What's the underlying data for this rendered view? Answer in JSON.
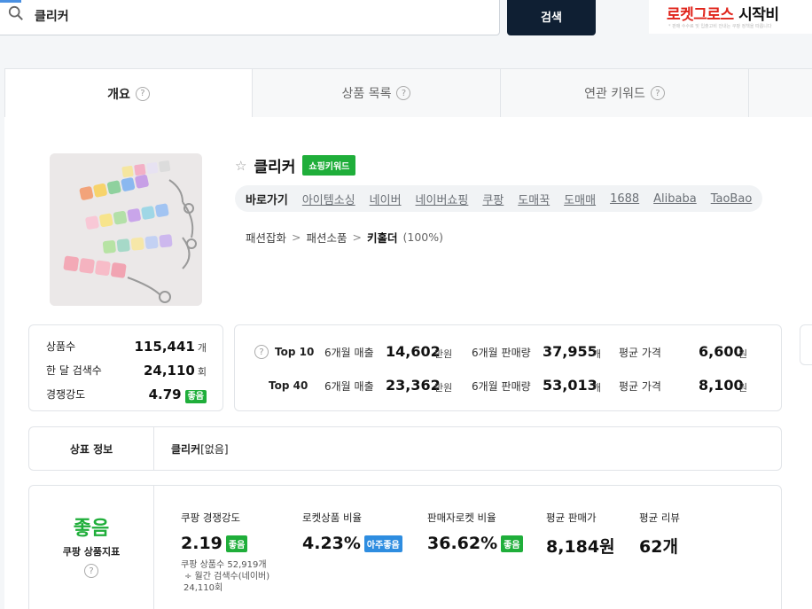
{
  "search": {
    "value": "클리커",
    "button_label": "검색"
  },
  "banner": {
    "text_red": "로켓그로스",
    "text_black": " 시작비",
    "subtext": "* 판매 수수료 및 입출고비 안내는 쿠팡 정책을 따릅니다"
  },
  "tabs": [
    {
      "label": "개요"
    },
    {
      "label": "상품 목록"
    },
    {
      "label": "연관 키워드"
    }
  ],
  "product": {
    "title": "클리커",
    "badge": "쇼핑키워드",
    "shortcut_label": "바로가기",
    "shortcuts": [
      "아이템소싱",
      "네이버",
      "네이버쇼핑",
      "쿠팡",
      "도매꾹",
      "도매매",
      "1688",
      "Alibaba",
      "TaoBao"
    ],
    "breadcrumb": [
      "패션잡화",
      "패션소품",
      "키홀더"
    ],
    "breadcrumb_pct": "(100%)"
  },
  "summary": {
    "product_count_label": "상품수",
    "product_count": "115,441",
    "product_count_unit": "개",
    "monthly_search_label": "한 달 검색수",
    "monthly_search": "24,110",
    "monthly_search_unit": "회",
    "competition_label": "경쟁강도",
    "competition": "4.79",
    "competition_tag": "좋음"
  },
  "top_stats": {
    "rows": [
      {
        "rank": "Top 10",
        "sales_label": "6개월 매출",
        "sales": "14,602",
        "sales_unit": "만원",
        "volume_label": "6개월 판매량",
        "volume": "37,955",
        "volume_unit": "개",
        "price_label": "평균 가격",
        "price": "6,600",
        "price_unit": "원"
      },
      {
        "rank": "Top 40",
        "sales_label": "6개월 매출",
        "sales": "23,362",
        "sales_unit": "만원",
        "volume_label": "6개월 판매량",
        "volume": "53,013",
        "volume_unit": "개",
        "price_label": "평균 가격",
        "price": "8,100",
        "price_unit": "원"
      }
    ]
  },
  "brand": {
    "label": "상표 정보",
    "value": "클리커",
    "value_suffix": "[없음]"
  },
  "coupang": {
    "grade": "좋음",
    "grade_label": "쿠팡 상품지표",
    "competition_label": "쿠팡 경쟁강도",
    "competition": "2.19",
    "competition_tag": "좋음",
    "competition_sub1": "쿠팡 상품수 52,919개",
    "competition_sub2": "÷ 월간 검색수(네이버)",
    "competition_sub3": "24,110회",
    "rocket_label": "로켓상품 비율",
    "rocket": "4.23%",
    "rocket_tag": "아주좋음",
    "seller_rocket_label": "판매자로켓 비율",
    "seller_rocket": "36.62%",
    "seller_rocket_tag": "좋음",
    "avg_price_label": "평균 판매가",
    "avg_price": "8,184원",
    "avg_review_label": "평균 리뷰",
    "avg_review": "62개"
  },
  "colors": {
    "accent_green": "#1fae3a",
    "accent_blue": "#2e8de0",
    "button_dark": "#0f1f33",
    "banner_red": "#e0241b"
  }
}
